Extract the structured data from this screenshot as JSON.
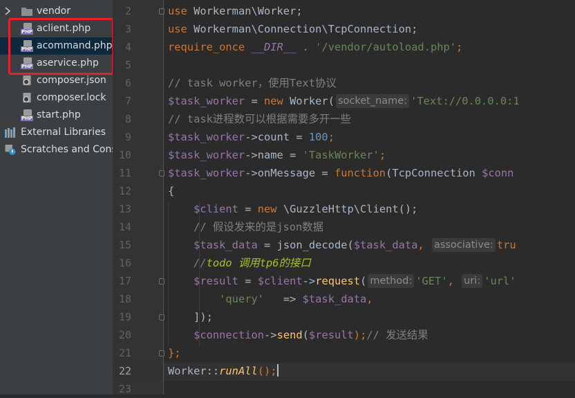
{
  "sidebar": {
    "items": [
      {
        "label": "vendor",
        "icon": "folder-icon"
      },
      {
        "label": "aclient.php",
        "icon": "php-file-icon"
      },
      {
        "label": "acommand.php",
        "icon": "php-file-icon"
      },
      {
        "label": "aservice.php",
        "icon": "php-file-icon"
      },
      {
        "label": "composer.json",
        "icon": "composer-file-icon"
      },
      {
        "label": "composer.lock",
        "icon": "composer-file-icon"
      },
      {
        "label": "start.php",
        "icon": "php-file-icon"
      },
      {
        "label": "External Libraries",
        "icon": "libraries-icon"
      },
      {
        "label": "Scratches and Consoles",
        "icon": "scratches-icon"
      }
    ],
    "php_tag": "PHP"
  },
  "editor": {
    "line_numbers": [
      "2",
      "3",
      "4",
      "5",
      "6",
      "7",
      "8",
      "9",
      "10",
      "11",
      "12",
      "13",
      "14",
      "15",
      "16",
      "17",
      "18",
      "19",
      "20",
      "21",
      "22",
      "23"
    ],
    "active_line": "22",
    "lines": {
      "l2": [
        "use",
        " Workerman\\Worker;"
      ],
      "l3": [
        "use",
        " Workerman\\Connection\\TcpConnection;"
      ],
      "l4": [
        "require_once",
        "__DIR__",
        " . ",
        "'/vendor/autoload.php'",
        ";"
      ],
      "l6": "// task worker，使用Text协议",
      "l7": [
        "$task_worker",
        " = ",
        "new",
        " Worker(",
        "socket_name:",
        "'Text://0.0.0.0:1"
      ],
      "l8": "// task进程数可以根据需要多开一些",
      "l9": [
        "$task_worker",
        "->count = ",
        "100",
        ";"
      ],
      "l10": [
        "$task_worker",
        "->name = ",
        "'TaskWorker'",
        ";"
      ],
      "l11": [
        "$task_worker",
        "->onMessage = ",
        "function",
        "(TcpConnection ",
        "$conn"
      ],
      "l12": "{",
      "l13": [
        "$client",
        " = ",
        "new",
        " \\GuzzleHttp\\Client();"
      ],
      "l14": "// 假设发来的是json数据",
      "l15": [
        "$task_data",
        " = json_decode(",
        "$task_data",
        ",",
        "associative:",
        "tru"
      ],
      "l16": [
        "//",
        "todo 调用tp6的接口"
      ],
      "l17": [
        "$result",
        " = ",
        "$client",
        "->",
        "request",
        "(",
        "method:",
        "'GET'",
        ",",
        "uri:",
        "'url'"
      ],
      "l18": [
        "'query'",
        "   => ",
        "$task_data",
        ","
      ],
      "l19": "]);",
      "l20": [
        "$connection",
        "->",
        "send",
        "(",
        "$result",
        ");",
        "// 发送结果"
      ],
      "l21": "};",
      "l22": [
        "Worker::",
        "runAll",
        "();"
      ]
    }
  },
  "colors": {
    "highlight_box": "#e8202a",
    "selected_row": "#0d293e"
  }
}
